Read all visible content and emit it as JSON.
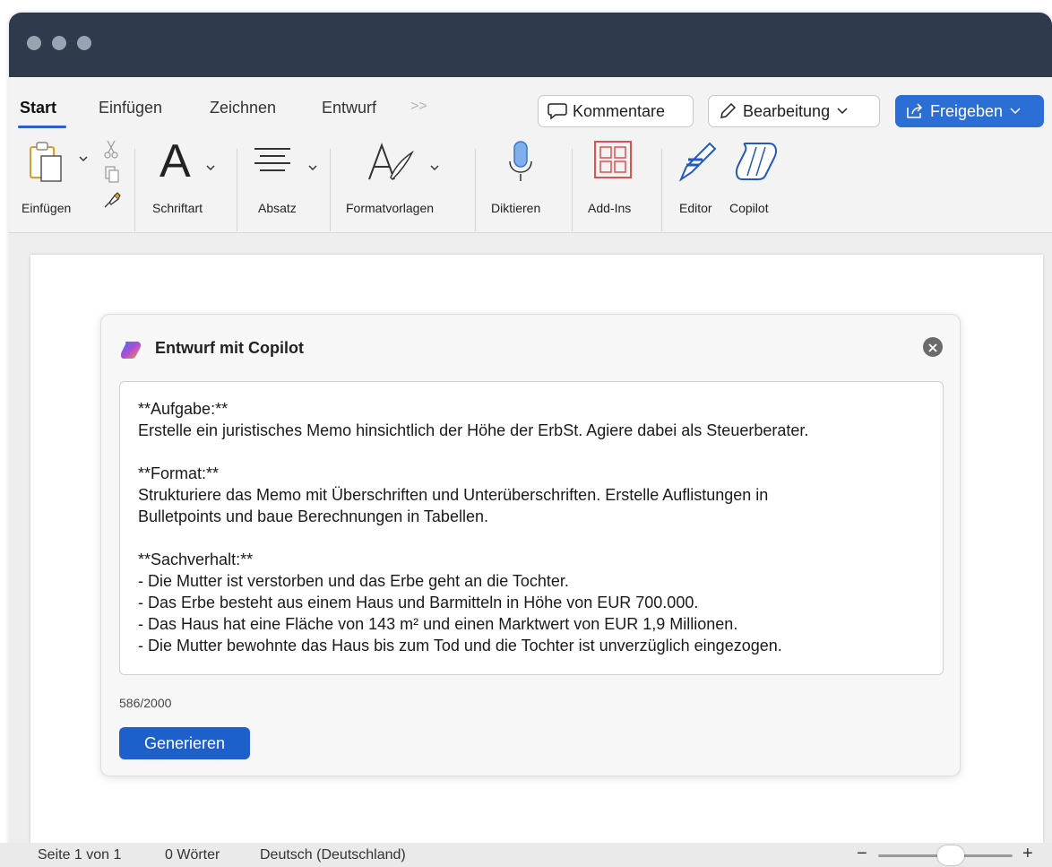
{
  "ribbon": {
    "tabs": [
      "Start",
      "Einfügen",
      "Zeichnen",
      "Entwurf"
    ],
    "more_icon": "double-chevron-right-icon",
    "comments_label": "Kommentare",
    "editing_label": "Bearbeitung",
    "share_label": "Freigeben",
    "tools": {
      "paste": "Einfügen",
      "font": "Schriftart",
      "paragraph": "Absatz",
      "styles": "Formatvorlagen",
      "dictate": "Diktieren",
      "addins": "Add-Ins",
      "editor": "Editor",
      "copilot": "Copilot"
    },
    "font_glyph": "A",
    "share_color": "#2b6fd6"
  },
  "copilot_dialog": {
    "title": "Entwurf mit Copilot",
    "prompt": {
      "task_heading": "**Aufgabe:**",
      "task_text": "Erstelle ein juristisches Memo hinsichtlich der Höhe der ErbSt. Agiere dabei als Steuerberater.",
      "format_heading": "**Format:**",
      "format_line1": "Strukturiere das Memo mit Überschriften und Unterüberschriften. Erstelle Auflistungen in",
      "format_line2": "Bulletpoints und baue Berechnungen in Tabellen.",
      "facts_heading": "**Sachverhalt:**",
      "facts": [
        "- Die Mutter ist verstorben und das Erbe geht an die Tochter.",
        "- Das Erbe besteht aus einem Haus und Barmitteln in Höhe von EUR 700.000.",
        "- Das Haus hat eine Fläche von 143 m² und einen Marktwert von EUR 1,9 Millionen.",
        "- Die Mutter bewohnte das Haus bis zum Tod und die Tochter ist unverzüglich eingezogen."
      ]
    },
    "counter": "586/2000",
    "generate_label": "Generieren",
    "generate_color": "#1d5fcb"
  },
  "status_bar": {
    "page": "Seite 1 von 1",
    "words": "0 Wörter",
    "language": "Deutsch (Deutschland)",
    "zoom_minus": "−",
    "zoom_plus": "+"
  }
}
